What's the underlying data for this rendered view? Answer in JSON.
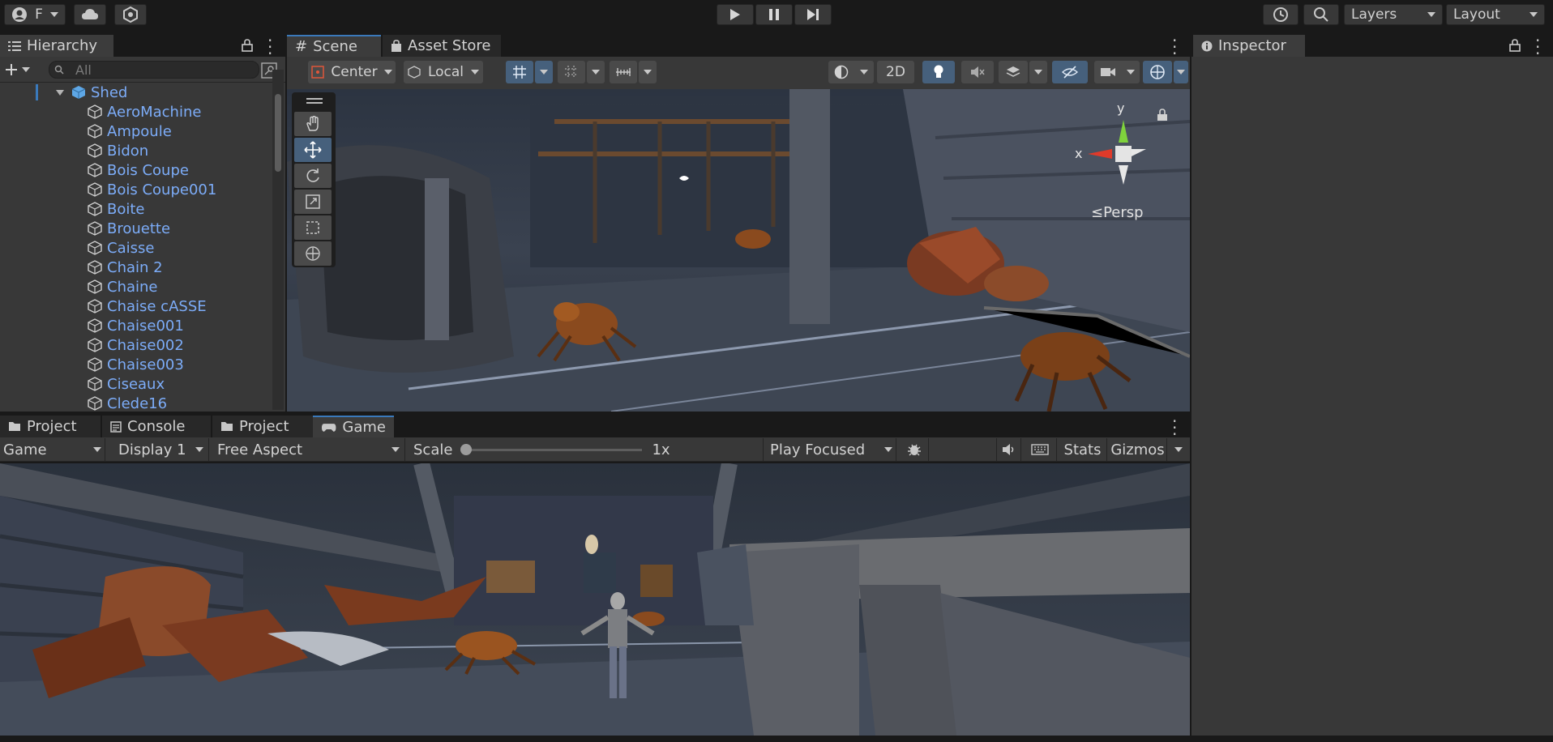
{
  "topbar": {
    "account_letter": "F",
    "layers_label": "Layers",
    "layout_label": "Layout"
  },
  "hierarchy": {
    "tab_label": "Hierarchy",
    "search_placeholder": "All",
    "root": "Shed",
    "items": [
      "AeroMachine",
      "Ampoule",
      "Bidon",
      "Bois Coupe",
      "Bois Coupe001",
      "Boite",
      "Brouette",
      "Caisse",
      "Chain 2",
      "Chaine",
      "Chaise cASSE",
      "Chaise001",
      "Chaise002",
      "Chaise003",
      "Ciseaux",
      "Clede16"
    ]
  },
  "scene": {
    "tab_scene": "Scene",
    "tab_asset_store": "Asset Store",
    "pivot_label": "Center",
    "space_label": "Local",
    "mode_2d": "2D",
    "gizmo_y": "y",
    "gizmo_x": "x",
    "persp_label": "≤Persp"
  },
  "inspector": {
    "tab_label": "Inspector"
  },
  "bottom": {
    "tabs": [
      "Project",
      "Console",
      "Project",
      "Game"
    ],
    "game_dd": "Game",
    "display_dd": "Display 1",
    "aspect_dd": "Free Aspect",
    "scale_label": "Scale",
    "scale_value": "1x",
    "play_focus": "Play Focused",
    "stats": "Stats",
    "gizmos": "Gizmos"
  },
  "colors": {
    "accent": "#3a79bb",
    "link": "#7cacf8",
    "panel": "#383838"
  }
}
